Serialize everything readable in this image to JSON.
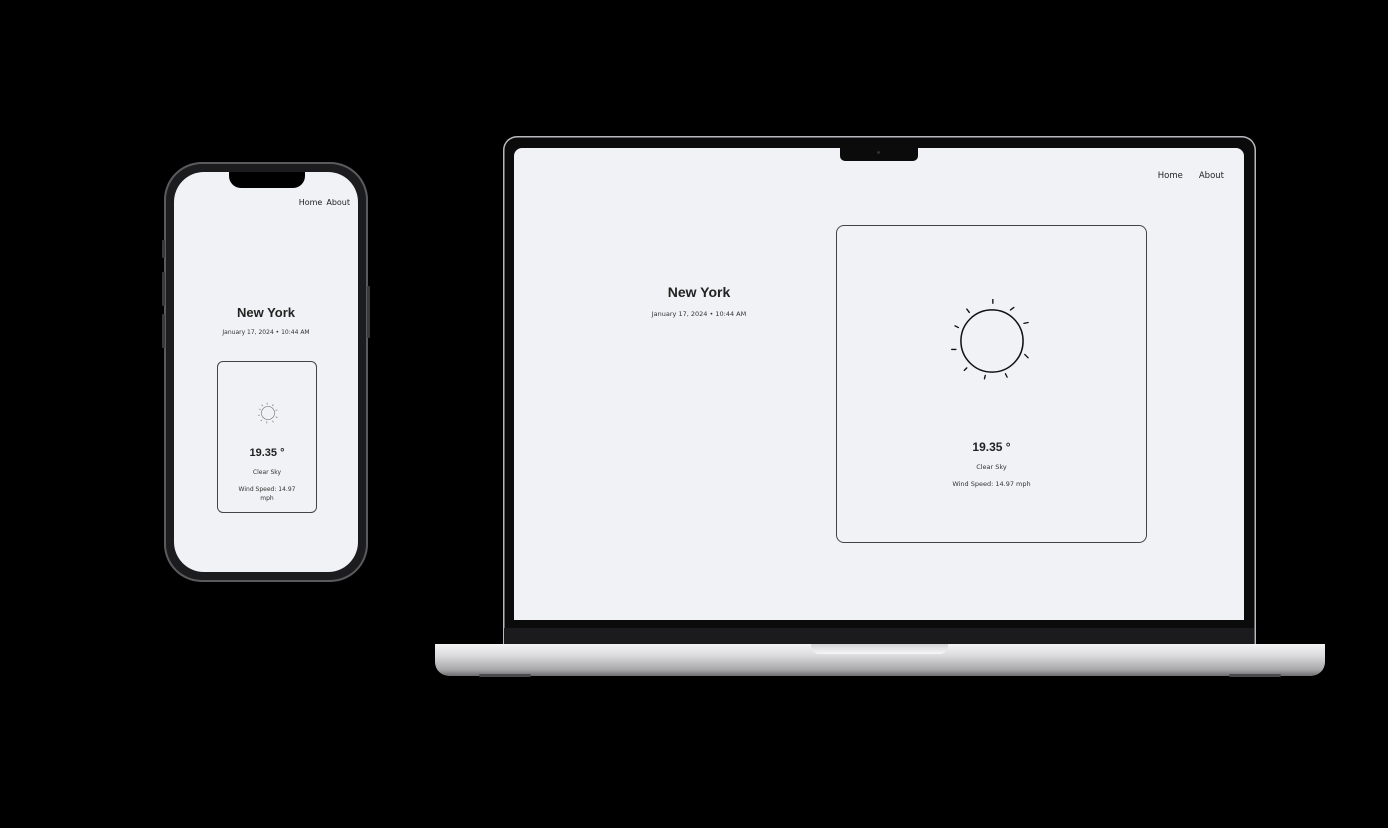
{
  "nav": {
    "home": "Home",
    "about": "About"
  },
  "location": {
    "city": "New York",
    "datetime": "January 17, 2024 • 10:44 AM"
  },
  "weather": {
    "temperature": "19.35 °",
    "condition": "Clear Sky",
    "wind": "Wind Speed: 14.97 mph",
    "wind_phone_line1": "Wind Speed: 14.97",
    "wind_phone_line2": "mph",
    "icon": "sun-icon"
  },
  "colors": {
    "page_background": "#f1f2f5",
    "text": "#222222",
    "border": "#444444",
    "frame": "#000000"
  }
}
